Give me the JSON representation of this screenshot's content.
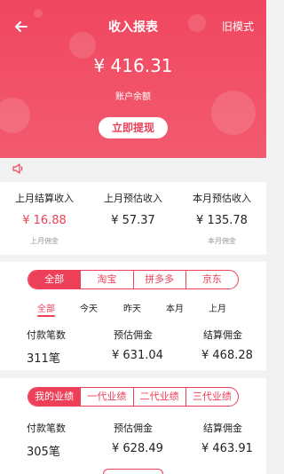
{
  "header": {
    "title": "收入报表",
    "old_mode": "旧模式",
    "balance": "¥ 416.31",
    "balance_label": "账户余额",
    "withdraw_label": "立即提现"
  },
  "summary": [
    {
      "label": "上月结算收入",
      "value": "¥ 16.88",
      "sub": "上月佣金"
    },
    {
      "label": "上月预估收入",
      "value": "¥ 57.37",
      "sub": ""
    },
    {
      "label": "本月预估收入",
      "value": "¥ 135.78",
      "sub": "本月佣金"
    }
  ],
  "platform_tabs": [
    "全部",
    "淘宝",
    "拼多多",
    "京东"
  ],
  "periods": [
    "全部",
    "今天",
    "昨天",
    "本月",
    "上月"
  ],
  "platform_stats": {
    "headers": [
      "付款笔数",
      "预估佣金",
      "结算佣金"
    ],
    "values": [
      "311笔",
      "¥ 631.04",
      "¥ 468.28"
    ]
  },
  "tier_tabs": [
    "我的业绩",
    "一代业绩",
    "二代业绩",
    "三代业绩"
  ],
  "tier_stats": {
    "headers": [
      "付款笔数",
      "预估佣金",
      "结算佣金"
    ],
    "values": [
      "305笔",
      "¥ 628.49",
      "¥ 463.91"
    ]
  },
  "colors": {
    "accent": "#ee3f58",
    "header_bg": "#f0475f"
  }
}
